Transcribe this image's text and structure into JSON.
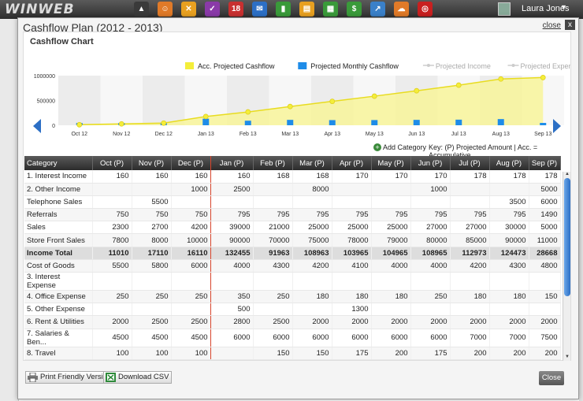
{
  "topbar": {
    "logo": "WINWEB",
    "apps": [
      {
        "icon": "photo-icon",
        "color": "#3a3a3a",
        "glyph": "▲"
      },
      {
        "icon": "people-icon",
        "color": "#e07a28",
        "glyph": "☺"
      },
      {
        "icon": "tools-icon",
        "color": "#e8a020",
        "glyph": "✕"
      },
      {
        "icon": "checkbox-icon",
        "color": "#8a3aa8",
        "glyph": "✓"
      },
      {
        "icon": "calendar-icon",
        "color": "#c83030",
        "glyph": "18"
      },
      {
        "icon": "mail-icon",
        "color": "#2c6fc5",
        "glyph": "✉"
      },
      {
        "icon": "chart-bar-icon",
        "color": "#3a9a3a",
        "glyph": "▮"
      },
      {
        "icon": "document-icon",
        "color": "#e8a020",
        "glyph": "▤"
      },
      {
        "icon": "spreadsheet-icon",
        "color": "#3a9a3a",
        "glyph": "▦"
      },
      {
        "icon": "finance-icon",
        "color": "#3a9a3a",
        "glyph": "$"
      },
      {
        "icon": "graph-icon",
        "color": "#3a80c8",
        "glyph": "↗"
      },
      {
        "icon": "cloud-icon",
        "color": "#e07a28",
        "glyph": "☁"
      },
      {
        "icon": "globe-icon",
        "color": "#c82020",
        "glyph": "◎"
      }
    ],
    "user_name": "Laura Jones"
  },
  "modal": {
    "title": "Cashflow Plan (2012 - 2013)",
    "close_link": "close",
    "close_x": "x",
    "chart_title": "Cashflow Chart",
    "add_category": "Add Category",
    "key_text": "Key: (P) Projected Amount | Acc. = Accumulative",
    "print_button": "Print Friendly Version",
    "csv_button": "Download CSV",
    "close_button": "Close"
  },
  "chart_data": {
    "type": "line",
    "x": [
      "Oct 12",
      "Nov 12",
      "Dec 12",
      "Jan 13",
      "Feb 13",
      "Mar 13",
      "Apr 13",
      "May 13",
      "Jun 13",
      "Jul 13",
      "Aug 13",
      "Sep 13"
    ],
    "yticks": [
      "0",
      "500000",
      "1000000"
    ],
    "ylim": [
      0,
      1000000
    ],
    "series": [
      {
        "name": "Acc. Projected Cashflow",
        "type": "area",
        "color": "#f4ee3a",
        "values": [
          11010,
          28120,
          44230,
          176685,
          268648,
          377611,
          481576,
          586241,
          695206,
          808179,
          932652,
          961320
        ]
      },
      {
        "name": "Projected Monthly Cashflow",
        "type": "bar",
        "color": "#1e8ce8",
        "values": [
          11010,
          17110,
          16110,
          132455,
          91963,
          108963,
          103965,
          104965,
          108965,
          112973,
          124473,
          28668
        ]
      },
      {
        "name": "Projected Income",
        "type": "line",
        "color": "#cccccc",
        "values": []
      },
      {
        "name": "Projected Expenses",
        "type": "line",
        "color": "#cccccc",
        "values": []
      }
    ],
    "legend": "top-right",
    "grid": false
  },
  "table": {
    "headers": [
      "Category",
      "Oct (P)",
      "Nov (P)",
      "Dec (P)",
      "Jan (P)",
      "Feb (P)",
      "Mar (P)",
      "Apr (P)",
      "May (P)",
      "Jun (P)",
      "Jul (P)",
      "Aug (P)",
      "Sep (P)"
    ],
    "rows": [
      {
        "cells": [
          "1. Interest Income",
          "160",
          "160",
          "160",
          "160",
          "168",
          "168",
          "170",
          "170",
          "170",
          "178",
          "178",
          "178"
        ]
      },
      {
        "cells": [
          "2. Other Income",
          "",
          "",
          "1000",
          "2500",
          "",
          "8000",
          "",
          "",
          "1000",
          "",
          "",
          "5000"
        ]
      },
      {
        "cells": [
          "Telephone Sales",
          "",
          "5500",
          "",
          "",
          "",
          "",
          "",
          "",
          "",
          "",
          "3500",
          "6000"
        ]
      },
      {
        "cells": [
          "Referrals",
          "750",
          "750",
          "750",
          "795",
          "795",
          "795",
          "795",
          "795",
          "795",
          "795",
          "795",
          "1490"
        ]
      },
      {
        "cells": [
          "Sales",
          "2300",
          "2700",
          "4200",
          "39000",
          "21000",
          "25000",
          "25000",
          "25000",
          "27000",
          "27000",
          "30000",
          "5000"
        ]
      },
      {
        "cells": [
          "Store Front Sales",
          "7800",
          "8000",
          "10000",
          "90000",
          "70000",
          "75000",
          "78000",
          "79000",
          "80000",
          "85000",
          "90000",
          "11000"
        ]
      },
      {
        "cells": [
          "Income Total",
          "11010",
          "17110",
          "16110",
          "132455",
          "91963",
          "108963",
          "103965",
          "104965",
          "108965",
          "112973",
          "124473",
          "28668"
        ],
        "total": true
      },
      {
        "cells": [
          "Cost of Goods",
          "5500",
          "5800",
          "6000",
          "4000",
          "4300",
          "4200",
          "4100",
          "4000",
          "4000",
          "4200",
          "4300",
          "4800"
        ]
      },
      {
        "cells": [
          "3. Interest Expense",
          "",
          "",
          "",
          "",
          "",
          "",
          "",
          "",
          "",
          "",
          "",
          ""
        ]
      },
      {
        "cells": [
          "4. Office Expense",
          "250",
          "250",
          "250",
          "350",
          "250",
          "180",
          "180",
          "180",
          "250",
          "180",
          "180",
          "150"
        ]
      },
      {
        "cells": [
          "5. Other Expense",
          "",
          "",
          "",
          "500",
          "",
          "",
          "1300",
          "",
          "",
          "",
          "",
          ""
        ]
      },
      {
        "cells": [
          "6. Rent & Utilities",
          "2000",
          "2500",
          "2500",
          "2800",
          "2500",
          "2000",
          "2000",
          "2000",
          "2000",
          "2000",
          "2000",
          "2000"
        ]
      },
      {
        "cells": [
          "7. Salaries & Ben...",
          "4500",
          "4500",
          "4500",
          "6000",
          "6000",
          "6000",
          "6000",
          "6000",
          "6000",
          "7000",
          "7000",
          "7500"
        ]
      },
      {
        "cells": [
          "8. Travel",
          "100",
          "100",
          "100",
          "",
          "150",
          "150",
          "175",
          "200",
          "175",
          "200",
          "200",
          "200"
        ]
      }
    ]
  }
}
